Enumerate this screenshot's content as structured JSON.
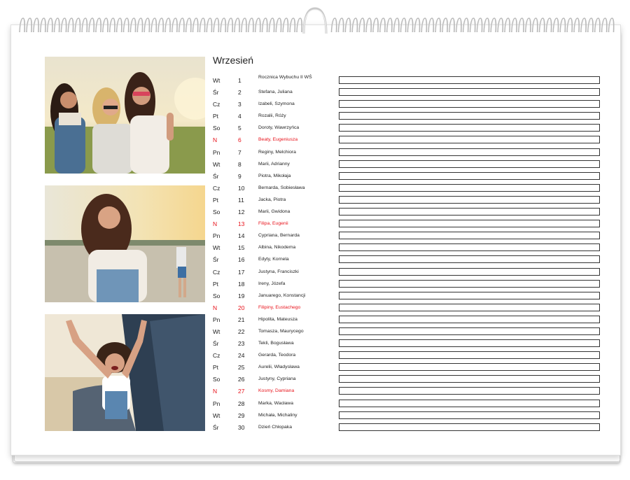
{
  "calendar": {
    "month": "Wrzesień",
    "days": [
      {
        "dow": "Wt",
        "num": "1",
        "names": "Rocznica Wybuchu II WŚ",
        "holiday": false
      },
      {
        "dow": "Śr",
        "num": "2",
        "names": "Stefana, Juliana",
        "holiday": false
      },
      {
        "dow": "Cz",
        "num": "3",
        "names": "Izabeli, Szymona",
        "holiday": false
      },
      {
        "dow": "Pt",
        "num": "4",
        "names": "Rozalii, Róży",
        "holiday": false
      },
      {
        "dow": "So",
        "num": "5",
        "names": "Doroty, Wawrzyńca",
        "holiday": false
      },
      {
        "dow": "N",
        "num": "6",
        "names": "Beaty, Eugeniusza",
        "holiday": true
      },
      {
        "dow": "Pn",
        "num": "7",
        "names": "Reginy, Melchiora",
        "holiday": false
      },
      {
        "dow": "Wt",
        "num": "8",
        "names": "Marii, Adrianny",
        "holiday": false
      },
      {
        "dow": "Śr",
        "num": "9",
        "names": "Piotra, Mikołaja",
        "holiday": false
      },
      {
        "dow": "Cz",
        "num": "10",
        "names": "Bernarda, Sobiesława",
        "holiday": false
      },
      {
        "dow": "Pt",
        "num": "11",
        "names": "Jacka, Piotra",
        "holiday": false
      },
      {
        "dow": "So",
        "num": "12",
        "names": "Marii, Gwidona",
        "holiday": false
      },
      {
        "dow": "N",
        "num": "13",
        "names": "Filipa, Eugenii",
        "holiday": true
      },
      {
        "dow": "Pn",
        "num": "14",
        "names": "Cypriana, Bernarda",
        "holiday": false
      },
      {
        "dow": "Wt",
        "num": "15",
        "names": "Albina, Nikodema",
        "holiday": false
      },
      {
        "dow": "Śr",
        "num": "16",
        "names": "Edyty, Kornela",
        "holiday": false
      },
      {
        "dow": "Cz",
        "num": "17",
        "names": "Justyna, Franciszki",
        "holiday": false
      },
      {
        "dow": "Pt",
        "num": "18",
        "names": "Ireny, Józefa",
        "holiday": false
      },
      {
        "dow": "So",
        "num": "19",
        "names": "Januarego, Konstancji",
        "holiday": false
      },
      {
        "dow": "N",
        "num": "20",
        "names": "Filipiny, Eustachego",
        "holiday": true
      },
      {
        "dow": "Pn",
        "num": "21",
        "names": "Hipolita, Mateusza",
        "holiday": false
      },
      {
        "dow": "Wt",
        "num": "22",
        "names": "Tomasza, Maurycego",
        "holiday": false
      },
      {
        "dow": "Śr",
        "num": "23",
        "names": "Tekli, Bogusława",
        "holiday": false
      },
      {
        "dow": "Cz",
        "num": "24",
        "names": "Gerarda, Teodora",
        "holiday": false
      },
      {
        "dow": "Pt",
        "num": "25",
        "names": "Aurelii, Władysława",
        "holiday": false
      },
      {
        "dow": "So",
        "num": "26",
        "names": "Justyny, Cypriana",
        "holiday": false
      },
      {
        "dow": "N",
        "num": "27",
        "names": "Kosmy, Damiana",
        "holiday": true
      },
      {
        "dow": "Pn",
        "num": "28",
        "names": "Marka, Wacława",
        "holiday": false
      },
      {
        "dow": "Wt",
        "num": "29",
        "names": "Michała, Michaliny",
        "holiday": false
      },
      {
        "dow": "Śr",
        "num": "30",
        "names": "Dzień Chłopaka",
        "holiday": false
      }
    ]
  },
  "colors": {
    "holiday": "#e8141c",
    "text": "#222222",
    "box_border": "#333333"
  }
}
